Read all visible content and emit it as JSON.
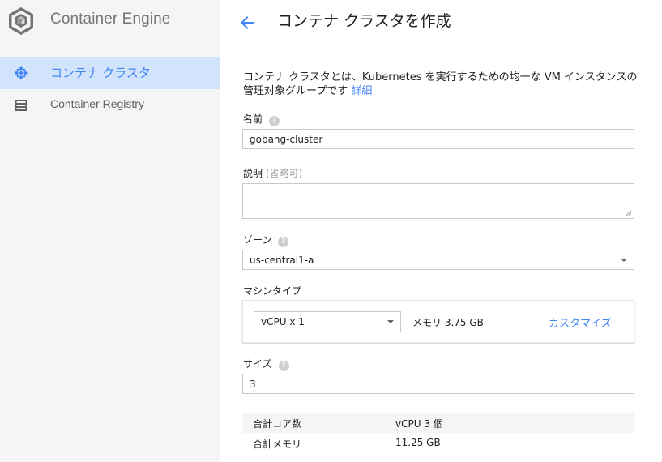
{
  "sidebar": {
    "app_name": "Container Engine",
    "items": [
      {
        "label": "コンテナ クラスタ",
        "active": true
      },
      {
        "label": "Container Registry",
        "active": false
      }
    ]
  },
  "header": {
    "title": "コンテナ クラスタを作成"
  },
  "intro": {
    "text": "コンテナ クラスタとは、Kubernetes を実行するための均一な VM インスタンスの管理対象グループです",
    "link": "詳細"
  },
  "form": {
    "name": {
      "label": "名前",
      "value": "gobang-cluster"
    },
    "description": {
      "label": "説明",
      "hint": "(省略可)",
      "value": ""
    },
    "zone": {
      "label": "ゾーン",
      "value": "us-central1-a"
    },
    "machine_type": {
      "label": "マシンタイプ",
      "cpu": "vCPU x 1",
      "memory": "メモリ 3.75 GB",
      "customize": "カスタマイズ"
    },
    "size": {
      "label": "サイズ",
      "value": "3"
    }
  },
  "totals": [
    {
      "key": "合計コア数",
      "value": "vCPU 3 個"
    },
    {
      "key": "合計メモリ",
      "value": "11.25 GB"
    }
  ],
  "icons": {
    "logo": "container-engine-hexagon-icon",
    "help": "help-circle-icon",
    "back": "arrow-left-icon"
  },
  "colors": {
    "accent": "#4285f4",
    "active_bg": "#d2e3fc"
  }
}
